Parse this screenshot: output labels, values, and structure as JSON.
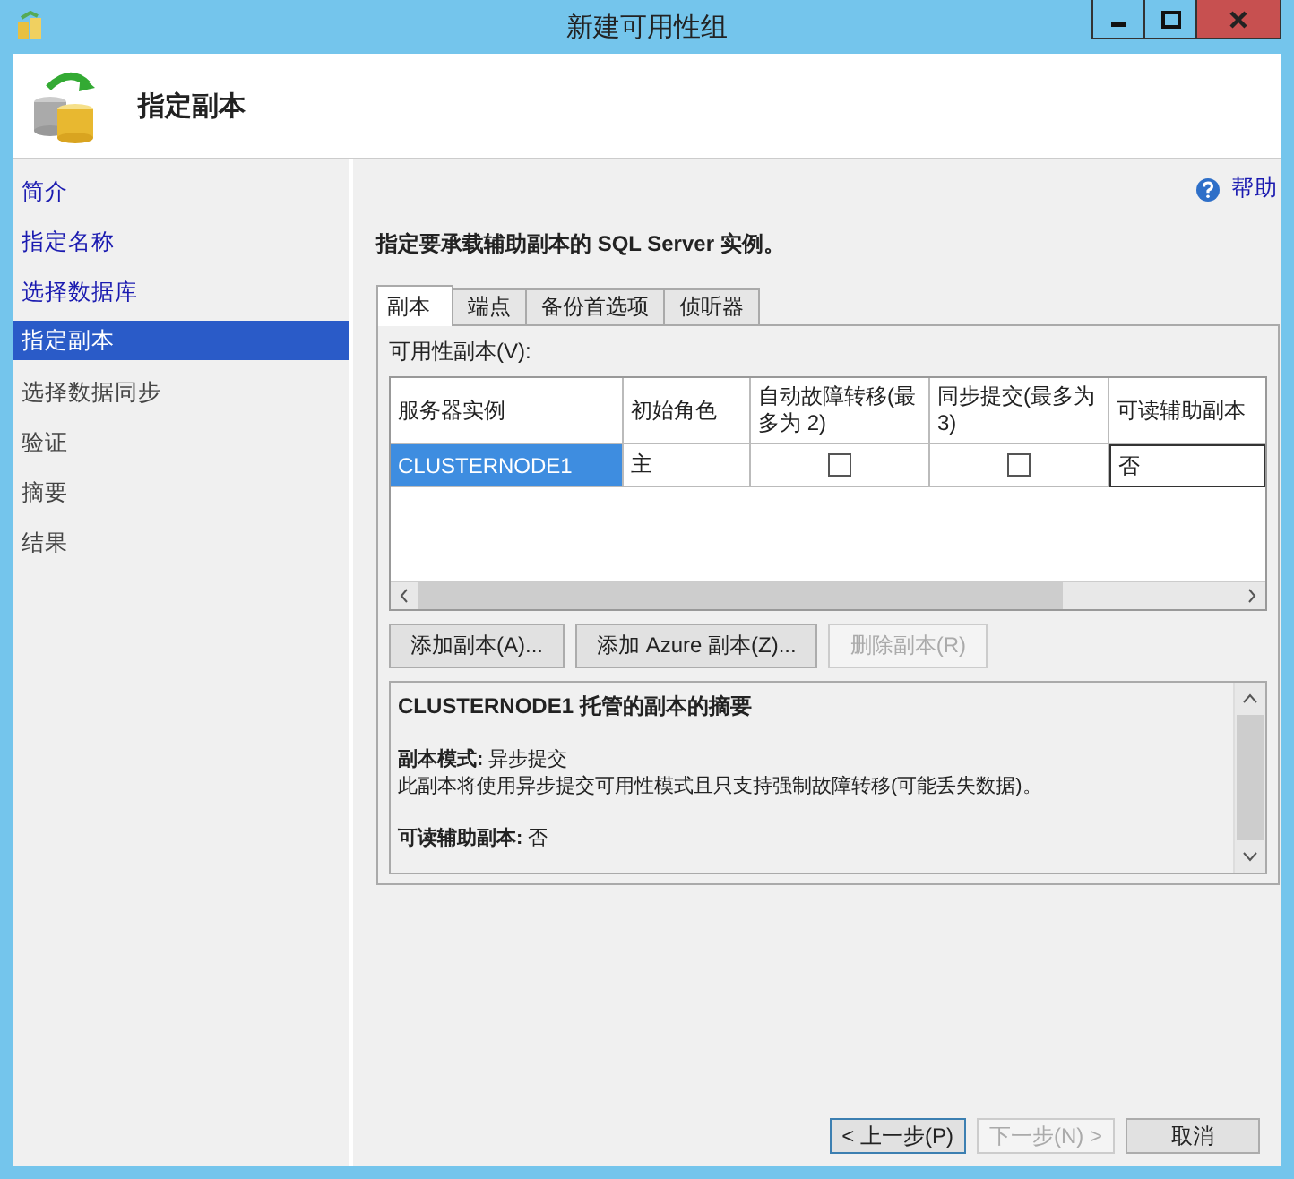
{
  "window": {
    "title": "新建可用性组"
  },
  "header": {
    "title": "指定副本"
  },
  "sidebar": {
    "items": [
      {
        "label": "简介",
        "selected": false,
        "completed": true
      },
      {
        "label": "指定名称",
        "selected": false,
        "completed": true
      },
      {
        "label": "选择数据库",
        "selected": false,
        "completed": true
      },
      {
        "label": "指定副本",
        "selected": true,
        "completed": false
      },
      {
        "label": "选择数据同步",
        "selected": false,
        "completed": false
      },
      {
        "label": "验证",
        "selected": false,
        "completed": false
      },
      {
        "label": "摘要",
        "selected": false,
        "completed": false
      },
      {
        "label": "结果",
        "selected": false,
        "completed": false
      }
    ]
  },
  "help": {
    "label": "帮助"
  },
  "instruction": "指定要承载辅助副本的 SQL Server 实例。",
  "tabs": [
    {
      "label": "副本",
      "selected": true
    },
    {
      "label": "端点",
      "selected": false
    },
    {
      "label": "备份首选项",
      "selected": false
    },
    {
      "label": "侦听器",
      "selected": false
    }
  ],
  "replicas": {
    "label": "可用性副本(V):",
    "columns": [
      "服务器实例",
      "初始角色",
      "自动故障转移(最多为 2)",
      "同步提交(最多为 3)",
      "可读辅助副本"
    ],
    "rows": [
      {
        "server": "CLUSTERNODE1",
        "role": "主",
        "auto_failover": false,
        "sync_commit": false,
        "readable": "否",
        "selected": true
      }
    ]
  },
  "buttons": [
    {
      "label": "添加副本(A)...",
      "disabled": false
    },
    {
      "label": "添加 Azure 副本(Z)...",
      "disabled": false
    },
    {
      "label": "删除副本(R)",
      "disabled": true
    }
  ],
  "summary": {
    "title": "CLUSTERNODE1 托管的副本的摘要",
    "paragraphs": [
      {
        "lines": [
          "**副本模式:** 异步提交",
          "此副本将使用异步提交可用性模式且只支持强制故障转移(可能丢失数据)。"
        ]
      },
      {
        "lines": [
          "**可读辅助副本:** 否"
        ]
      }
    ]
  },
  "footer": {
    "buttons": [
      {
        "label": "< 上一步(P)",
        "disabled": false,
        "default": true
      },
      {
        "label": "下一步(N) >",
        "disabled": true,
        "default": false
      },
      {
        "label": "取消",
        "disabled": false,
        "default": false
      }
    ]
  }
}
